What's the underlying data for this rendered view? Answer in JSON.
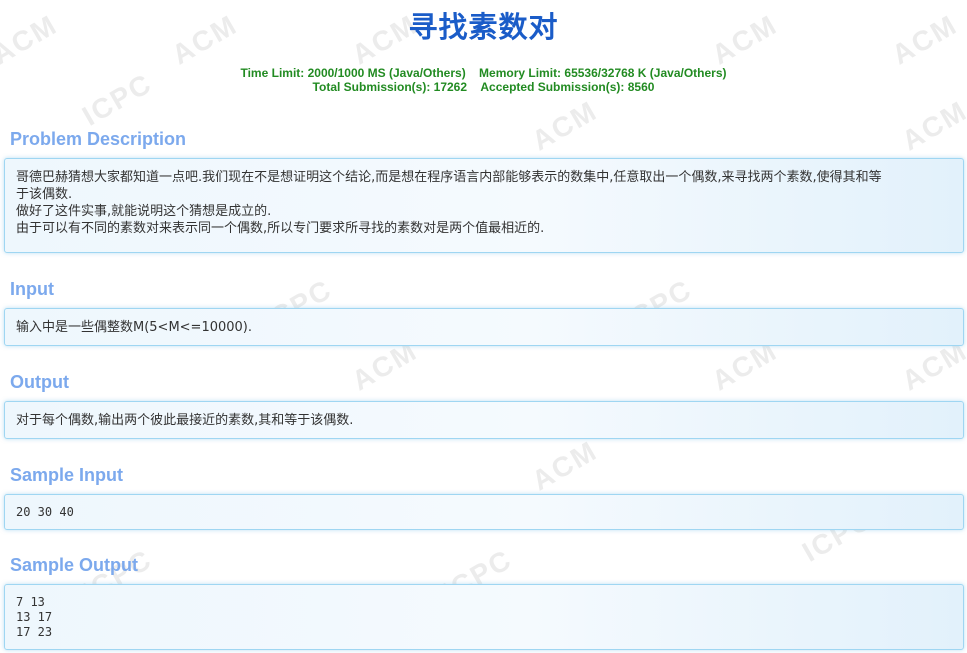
{
  "problem": {
    "title": "寻找素数对",
    "time_limit": "Time Limit: 2000/1000 MS (Java/Others)",
    "memory_limit": "Memory Limit: 65536/32768 K (Java/Others)",
    "total_submissions": "Total Submission(s): 17262",
    "accepted_submissions": "Accepted Submission(s): 8560"
  },
  "watermark": {
    "left_text": "ACM",
    "right_text": "ICPC"
  },
  "sections": {
    "description": {
      "title": "Problem Description",
      "lines": [
        "哥德巴赫猜想大家都知道一点吧.我们现在不是想证明这个结论,而是想在程序语言内部能够表示的数集中,任意取出一个偶数,来寻找两个素数,使得其和等",
        "于该偶数.",
        "做好了这件实事,就能说明这个猜想是成立的.",
        "由于可以有不同的素数对来表示同一个偶数,所以专门要求所寻找的素数对是两个值最相近的."
      ]
    },
    "input": {
      "title": "Input",
      "lines": [
        "输入中是一些偶整数M(5<M<=10000)."
      ]
    },
    "output": {
      "title": "Output",
      "lines": [
        "对于每个偶数,输出两个彼此最接近的素数,其和等于该偶数."
      ]
    },
    "sample_input": {
      "title": "Sample Input",
      "lines": [
        "20 30 40"
      ]
    },
    "sample_output": {
      "title": "Sample Output",
      "lines": [
        "7 13",
        "13 17",
        "17 23"
      ]
    }
  }
}
